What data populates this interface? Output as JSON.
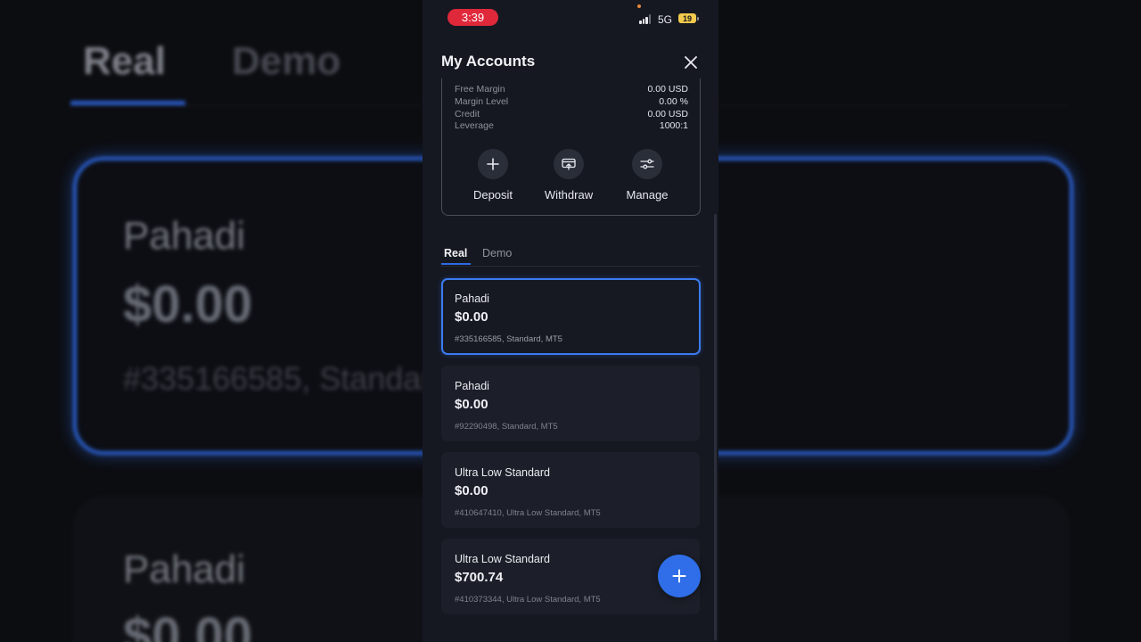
{
  "status_bar": {
    "time": "3:39",
    "network": "5G",
    "battery": "19"
  },
  "header": {
    "title": "My Accounts"
  },
  "account_details": [
    {
      "label": "Free Margin",
      "value": "0.00 USD"
    },
    {
      "label": "Margin Level",
      "value": "0.00 %"
    },
    {
      "label": "Credit",
      "value": "0.00 USD"
    },
    {
      "label": "Leverage",
      "value": "1000:1"
    }
  ],
  "actions": [
    {
      "label": "Deposit",
      "icon": "plus-icon"
    },
    {
      "label": "Withdraw",
      "icon": "withdraw-icon"
    },
    {
      "label": "Manage",
      "icon": "sliders-icon"
    }
  ],
  "tabs": [
    {
      "label": "Real",
      "active": true
    },
    {
      "label": "Demo",
      "active": false
    }
  ],
  "accounts": [
    {
      "name": "Pahadi",
      "balance": "$0.00",
      "details": "#335166585, Standard, MT5",
      "selected": true
    },
    {
      "name": "Pahadi",
      "balance": "$0.00",
      "details": "#92290498, Standard, MT5",
      "selected": false
    },
    {
      "name": "Ultra Low Standard",
      "balance": "$0.00",
      "details": "#410647410, Ultra Low Standard, MT5",
      "selected": false
    },
    {
      "name": "Ultra Low Standard",
      "balance": "$700.74",
      "details": "#410373344, Ultra Low Standard, MT5",
      "selected": false
    }
  ],
  "colors": {
    "accent": "#2f6ee8",
    "time_pill": "#e0283b",
    "panel": "#151821",
    "card": "#1c1f29"
  }
}
